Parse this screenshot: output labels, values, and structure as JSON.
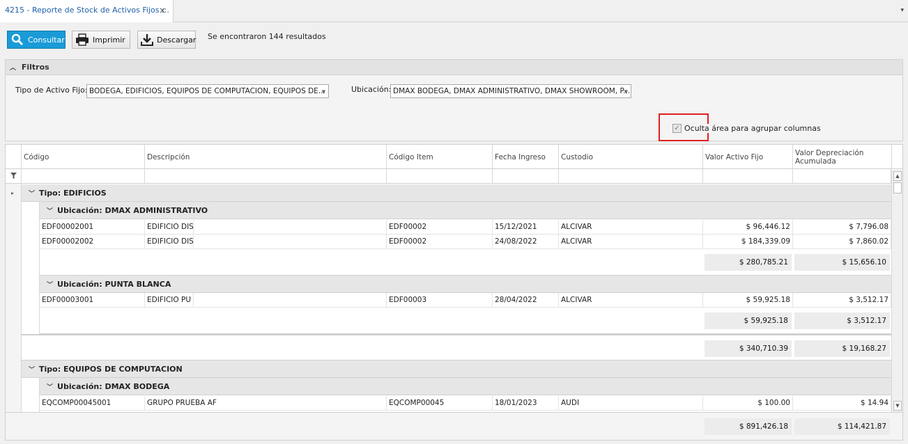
{
  "tab": {
    "title": "4215 - Reporte de Stock de Activos Fijos ::.",
    "close": "×",
    "menu": "▾"
  },
  "toolbar": {
    "consultar": "Consultar",
    "imprimir": "Imprimir",
    "descargar": "Descargar",
    "results": "Se encontraron 144 resultados"
  },
  "filters": {
    "title": "Filtros",
    "tipo_label": "Tipo de Activo Fijo:",
    "tipo_value": "BODEGA, EDIFICIOS, EQUIPOS DE COMPUTACION, EQUIPOS DE...",
    "ubicacion_label": "Ubicación:",
    "ubicacion_value": "DMAX  BODEGA, DMAX ADMINISTRATIVO, DMAX SHOWROOM, P...",
    "hide_group_label": "Oculta área para agrupar columnas"
  },
  "columns": [
    "Código",
    "Descripción",
    "Código Item",
    "Fecha Ingreso",
    "Custodio",
    "Valor Activo Fijo",
    "Valor Depreciación Acumulada"
  ],
  "groups": {
    "g1": "Tipo: EDIFICIOS",
    "g1a": "Ubicación: DMAX ADMINISTRATIVO",
    "g1b": "Ubicación: PUNTA BLANCA",
    "g2": "Tipo: EQUIPOS DE COMPUTACION",
    "g2a": "Ubicación: DMAX  BODEGA"
  },
  "rows": [
    [
      "EDF00002001",
      "EDIFICIO DIS",
      "EDF00002",
      "15/12/2021",
      "ALCIVAR",
      "$ 96,446.12",
      "$ 7,796.08"
    ],
    [
      "EDF00002002",
      "EDIFICIO DIS",
      "EDF00002",
      "24/08/2022",
      "ALCIVAR",
      "$ 184,339.09",
      "$ 7,860.02"
    ],
    [
      "EDF00003001",
      "EDIFICIO PU",
      "EDF00003",
      "28/04/2022",
      "ALCIVAR",
      "$ 59,925.18",
      "$ 3,512.17"
    ],
    [
      "EQCOMP00045001",
      "GRUPO PRUEBA AF",
      "EQCOMP00045",
      "18/01/2023",
      "AUDI",
      "$ 100.00",
      "$ 14.94"
    ]
  ],
  "sums": {
    "g1a_valor": "$ 280,785.21",
    "g1a_dep": "$ 15,656.10",
    "g1b_valor": "$ 59,925.18",
    "g1b_dep": "$ 3,512.17",
    "g1_valor": "$ 340,710.39",
    "g1_dep": "$ 19,168.27",
    "total_valor": "$ 891,426.18",
    "total_dep": "$ 114,421.87"
  }
}
